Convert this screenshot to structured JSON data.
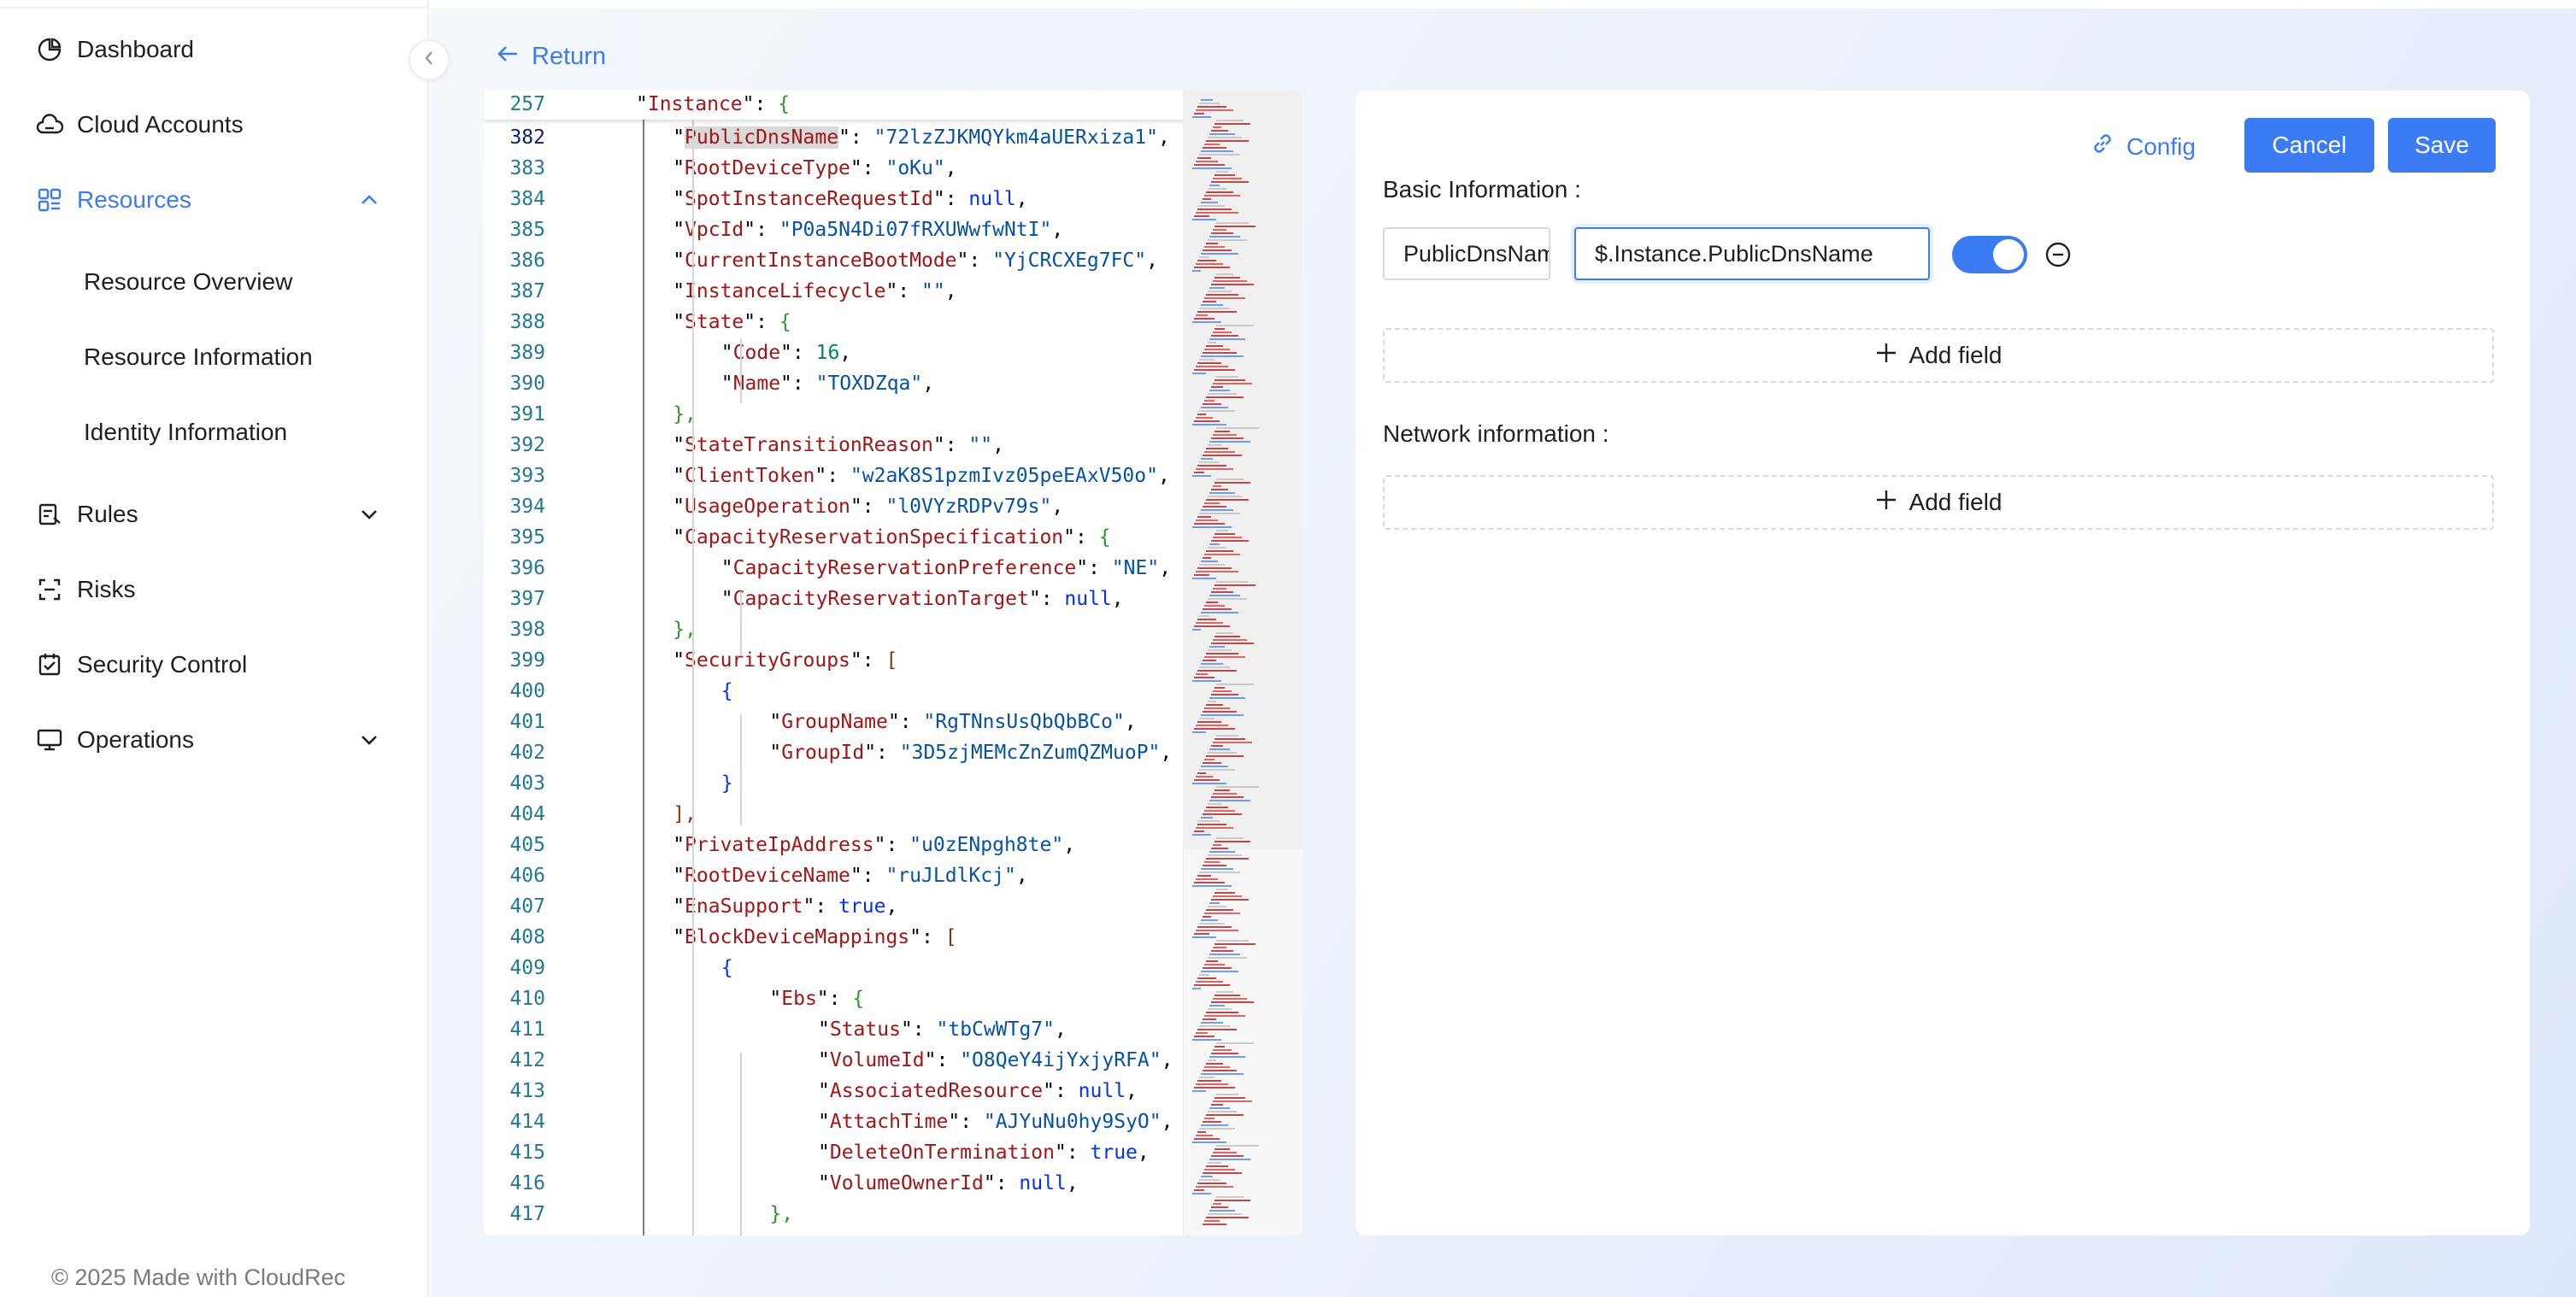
{
  "sidebar": {
    "items": [
      {
        "label": "Dashboard",
        "icon": "pie-chart-icon"
      },
      {
        "label": "Cloud Accounts",
        "icon": "cloud-icon"
      },
      {
        "label": "Resources",
        "icon": "grid-icon",
        "active": true,
        "expanded": true
      },
      {
        "label": "Resource Overview"
      },
      {
        "label": "Resource Information"
      },
      {
        "label": "Identity Information"
      },
      {
        "label": "Rules",
        "icon": "rules-icon"
      },
      {
        "label": "Risks",
        "icon": "risks-icon"
      },
      {
        "label": "Security Control",
        "icon": "checklist-icon"
      },
      {
        "label": "Operations",
        "icon": "monitor-icon"
      }
    ],
    "footer": "© 2025 Made with CloudRec"
  },
  "header": {
    "return_label": "Return"
  },
  "editor": {
    "sticky_line": {
      "num": "257",
      "key": "Instance"
    },
    "lines": [
      {
        "num": "382",
        "key": "PublicDnsName",
        "val": "72lzZJKMQYkm4aUERxiza1",
        "type": "s"
      },
      {
        "num": "383",
        "key": "RootDeviceType",
        "val": "oKu",
        "type": "s"
      },
      {
        "num": "384",
        "key": "SpotInstanceRequestId",
        "val": "null",
        "type": "b"
      },
      {
        "num": "385",
        "key": "VpcId",
        "val": "P0a5N4Di07fRXUWwfwNtI",
        "type": "s"
      },
      {
        "num": "386",
        "key": "CurrentInstanceBootMode",
        "val": "YjCRCXEg7FC",
        "type": "s"
      },
      {
        "num": "387",
        "key": "InstanceLifecycle",
        "val": "",
        "type": "s"
      },
      {
        "num": "388",
        "key": "State",
        "val": "{",
        "type": "open"
      },
      {
        "num": "389",
        "key": "Code",
        "val": "16",
        "type": "n"
      },
      {
        "num": "390",
        "key": "Name",
        "val": "TOXDZqa",
        "type": "s"
      },
      {
        "num": "391",
        "key": "",
        "val": "},",
        "type": "close"
      },
      {
        "num": "392",
        "key": "StateTransitionReason",
        "val": "",
        "type": "s"
      },
      {
        "num": "393",
        "key": "ClientToken",
        "val": "w2aK8S1pzmIvz05peEAxV50o",
        "type": "s"
      },
      {
        "num": "394",
        "key": "UsageOperation",
        "val": "l0VYzRDPv79s",
        "type": "s"
      },
      {
        "num": "395",
        "key": "CapacityReservationSpecification",
        "val": "{",
        "type": "open"
      },
      {
        "num": "396",
        "key": "CapacityReservationPreference",
        "val": "NE",
        "type": "s"
      },
      {
        "num": "397",
        "key": "CapacityReservationTarget",
        "val": "null",
        "type": "b"
      },
      {
        "num": "398",
        "key": "",
        "val": "},",
        "type": "close"
      },
      {
        "num": "399",
        "key": "SecurityGroups",
        "val": "[",
        "type": "open"
      },
      {
        "num": "400",
        "key": "",
        "val": "{",
        "type": "brace"
      },
      {
        "num": "401",
        "key": "GroupName",
        "val": "RgTNnsUsQbQbBCo",
        "type": "s"
      },
      {
        "num": "402",
        "key": "GroupId",
        "val": "3D5zjMEMcZnZumQZMuoP",
        "type": "s"
      },
      {
        "num": "403",
        "key": "",
        "val": "}",
        "type": "brace"
      },
      {
        "num": "404",
        "key": "",
        "val": "],",
        "type": "close"
      },
      {
        "num": "405",
        "key": "PrivateIpAddress",
        "val": "u0zENpgh8te",
        "type": "s"
      },
      {
        "num": "406",
        "key": "RootDeviceName",
        "val": "ruJLdlKcj",
        "type": "s"
      },
      {
        "num": "407",
        "key": "EnaSupport",
        "val": "true",
        "type": "b"
      },
      {
        "num": "408",
        "key": "BlockDeviceMappings",
        "val": "[",
        "type": "open"
      },
      {
        "num": "409",
        "key": "",
        "val": "{",
        "type": "brace"
      },
      {
        "num": "410",
        "key": "Ebs",
        "val": "{",
        "type": "open2"
      },
      {
        "num": "411",
        "key": "Status",
        "val": "tbCwWTg7",
        "type": "s"
      },
      {
        "num": "412",
        "key": "VolumeId",
        "val": "O8QeY4ijYxjyRFA",
        "type": "s"
      },
      {
        "num": "413",
        "key": "AssociatedResource",
        "val": "null",
        "type": "b"
      },
      {
        "num": "414",
        "key": "AttachTime",
        "val": "AJYuNu0hy9SyO",
        "type": "s"
      },
      {
        "num": "415",
        "key": "DeleteOnTermination",
        "val": "true",
        "type": "b"
      },
      {
        "num": "416",
        "key": "VolumeOwnerId",
        "val": "null",
        "type": "b"
      },
      {
        "num": "417",
        "key": "",
        "val": "},",
        "type": "close2"
      }
    ]
  },
  "panel": {
    "config_label": "Config",
    "cancel_label": "Cancel",
    "save_label": "Save",
    "basic_title": "Basic Information :",
    "field_key": "PublicDnsName",
    "field_value": "$.Instance.PublicDnsName",
    "add_field_label": "Add field",
    "network_title": "Network information :"
  },
  "colors": {
    "accent": "#3b7cf5"
  }
}
